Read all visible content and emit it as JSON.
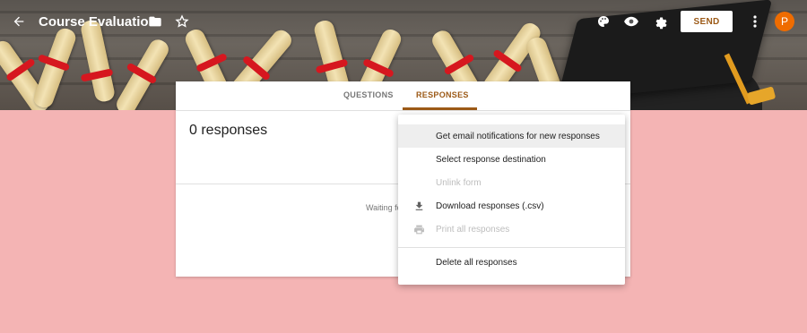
{
  "toolbar": {
    "title": "Course Evaluation",
    "send_label": "SEND",
    "avatar_initial": "P"
  },
  "tabs": [
    {
      "label": "QUESTIONS"
    },
    {
      "label": "RESPONSES"
    }
  ],
  "responses": {
    "count_text": "0 responses",
    "waiting_text": "Waiting fo"
  },
  "menu": {
    "items": [
      {
        "label": "Get email notifications for new responses",
        "disabled": false,
        "icon": ""
      },
      {
        "label": "Select response destination",
        "disabled": false,
        "icon": ""
      },
      {
        "label": "Unlink form",
        "disabled": true,
        "icon": ""
      },
      {
        "label": "Download responses (.csv)",
        "disabled": false,
        "icon": "download-icon"
      },
      {
        "label": "Print all responses",
        "disabled": true,
        "icon": "print-icon"
      },
      {
        "label": "Delete all responses",
        "disabled": false,
        "icon": ""
      }
    ]
  },
  "colors": {
    "accent": "#9c5a17",
    "background": "#f4b4b4",
    "avatar": "#ef6c00"
  }
}
